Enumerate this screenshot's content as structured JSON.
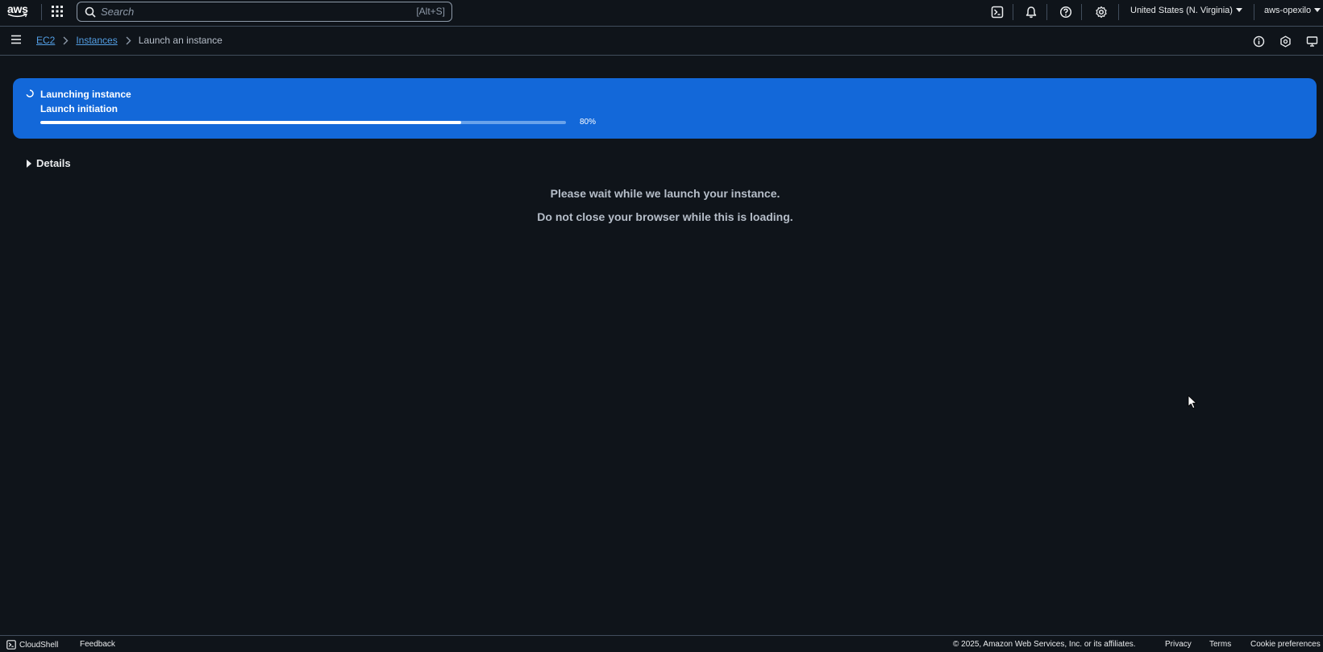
{
  "topnav": {
    "logo_text": "aws",
    "search": {
      "placeholder": "Search",
      "shortcut": "[Alt+S]"
    },
    "region": "United States (N. Virginia)",
    "account": "aws-opexilo"
  },
  "breadcrumb": {
    "items": [
      "EC2",
      "Instances"
    ],
    "current": "Launch an instance"
  },
  "flash": {
    "title": "Launching instance",
    "subtitle": "Launch initiation",
    "progress": 0.8,
    "progress_label": "80%",
    "accent_color": "#1368d9"
  },
  "details": {
    "label": "Details"
  },
  "messages": {
    "line1": "Please wait while we launch your instance.",
    "line2": "Do not close your browser while this is loading."
  },
  "footer": {
    "cloudshell": "CloudShell",
    "feedback": "Feedback",
    "copyright": "© 2025, Amazon Web Services, Inc. or its affiliates.",
    "privacy": "Privacy",
    "terms": "Terms",
    "cookie": "Cookie preferences"
  },
  "icons": {
    "topnav": [
      "services-grid-icon",
      "search-icon",
      "cloudshell-icon",
      "notifications-bell-icon",
      "help-icon",
      "settings-gear-icon"
    ],
    "breadcrumb_tools": [
      "info-icon",
      "feedback-hexagon-icon",
      "display-preferences-icon"
    ]
  }
}
